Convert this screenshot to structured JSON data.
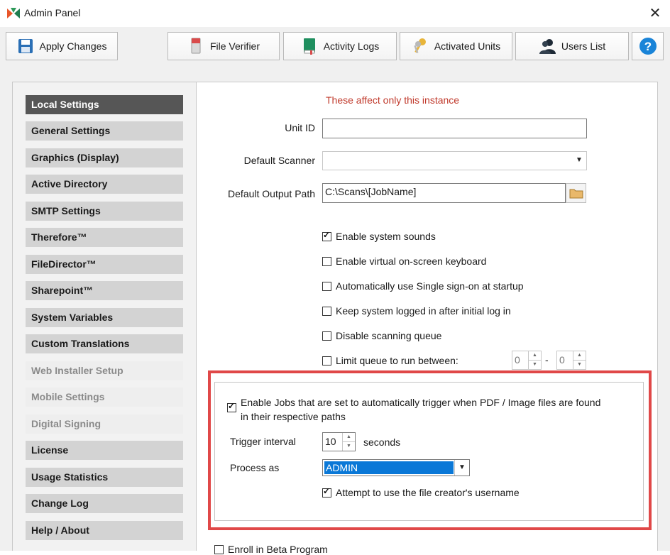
{
  "window": {
    "title": "Admin Panel",
    "close_icon": "close-icon"
  },
  "toolbar": {
    "apply_label": "Apply Changes",
    "file_verifier_label": "File Verifier",
    "activity_logs_label": "Activity Logs",
    "activated_units_label": "Activated Units",
    "users_list_label": "Users List",
    "help_label": "?"
  },
  "sidebar": {
    "items": [
      {
        "label": "Local Settings"
      },
      {
        "label": "General Settings"
      },
      {
        "label": "Graphics (Display)"
      },
      {
        "label": "Active Directory"
      },
      {
        "label": "SMTP Settings"
      },
      {
        "label": "Therefore™"
      },
      {
        "label": "FileDirector™"
      },
      {
        "label": "Sharepoint™"
      },
      {
        "label": "System Variables"
      },
      {
        "label": "Custom Translations"
      },
      {
        "label": "Web Installer Setup"
      },
      {
        "label": "Mobile Settings"
      },
      {
        "label": "Digital Signing"
      },
      {
        "label": "License"
      },
      {
        "label": "Usage Statistics"
      },
      {
        "label": "Change Log"
      },
      {
        "label": "Help / About"
      }
    ]
  },
  "main": {
    "note": "These affect only this instance",
    "unit_id_label": "Unit ID",
    "unit_id_value": "",
    "default_scanner_label": "Default Scanner",
    "default_scanner_value": "",
    "default_output_path_label": "Default Output Path",
    "default_output_path_value": "C:\\Scans\\[JobName]",
    "checkboxes": [
      {
        "label": "Enable system sounds",
        "checked": true
      },
      {
        "label": "Enable virtual on-screen keyboard",
        "checked": false
      },
      {
        "label": "Automatically use Single sign-on at startup",
        "checked": false
      },
      {
        "label": "Keep system logged in after initial log in",
        "checked": false
      },
      {
        "label": "Disable scanning queue",
        "checked": false
      },
      {
        "label": "Limit queue to run between:",
        "checked": false
      }
    ],
    "queue_from": "0",
    "queue_separator": "-",
    "queue_to": "0"
  },
  "auto_trigger": {
    "enable_label": "Enable Jobs that are set to automatically trigger when PDF / Image files are found in their respective paths",
    "enable_checked": true,
    "trigger_interval_label": "Trigger interval",
    "trigger_interval_value": "10",
    "trigger_interval_unit": "seconds",
    "process_as_label": "Process as",
    "process_as_value": "ADMIN",
    "use_creator_label": "Attempt to use the file creator's username",
    "use_creator_checked": true
  },
  "footer": {
    "beta_label": "Enroll in Beta Program"
  },
  "colors": {
    "note": "#c0392b",
    "highlight_border": "#e04848",
    "selection": "#0a78d7",
    "active_sidebar": "#565656"
  }
}
